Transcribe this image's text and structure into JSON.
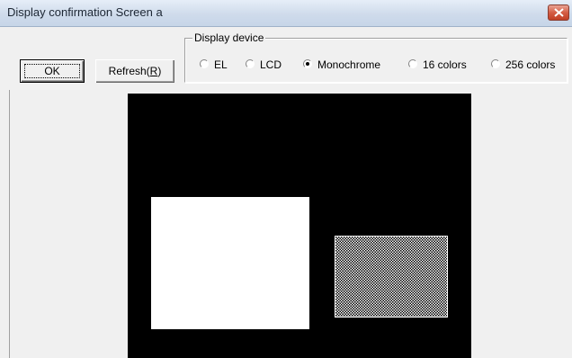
{
  "window": {
    "title": "Display confirmation Screen a"
  },
  "toolbar": {
    "ok_label": "OK",
    "refresh_label": "Refresh(R)",
    "refresh_text": "Refresh(",
    "refresh_mnemonic": "R",
    "refresh_close": ")"
  },
  "display_device": {
    "legend": "Display device",
    "options": [
      {
        "label": "EL",
        "selected": false
      },
      {
        "label": "LCD",
        "selected": false
      },
      {
        "label": "Monochrome",
        "selected": true
      },
      {
        "label": "16 colors",
        "selected": false
      },
      {
        "label": "256 colors",
        "selected": false
      }
    ]
  },
  "preview": {
    "background_color": "#000000",
    "shapes": [
      {
        "kind": "filled-rectangle",
        "color": "#ffffff"
      },
      {
        "kind": "checkered-rectangle",
        "color": "#ffffff"
      }
    ]
  },
  "colors": {
    "title_bar": "#cfdbeb",
    "close_button": "#d45e45",
    "window_bg": "#f0f0f0"
  }
}
